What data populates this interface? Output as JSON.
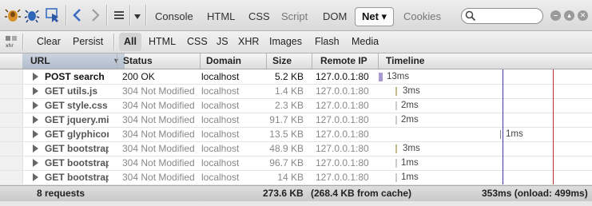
{
  "toolbar": {
    "tabs": [
      {
        "label": "Console"
      },
      {
        "label": "HTML"
      },
      {
        "label": "CSS"
      },
      {
        "label": "Script"
      },
      {
        "label": "DOM"
      },
      {
        "label": "Net ▾"
      },
      {
        "label": "Cookies"
      }
    ],
    "active_tab": "Net",
    "search": {
      "value": "",
      "placeholder": ""
    }
  },
  "net_toolbar": {
    "clear_label": "Clear",
    "persist_label": "Persist",
    "filters": [
      "All",
      "HTML",
      "CSS",
      "JS",
      "XHR",
      "Images",
      "Flash",
      "Media"
    ],
    "active_filter": "All"
  },
  "table": {
    "headers": {
      "url": "URL",
      "status": "Status",
      "domain": "Domain",
      "size": "Size",
      "remote_ip": "Remote IP",
      "timeline": "Timeline"
    },
    "rows": [
      {
        "url": "POST search",
        "status": "200 OK",
        "domain": "localhost",
        "size": "5.2 KB",
        "ip": "127.0.0.1:80",
        "time": "13ms"
      },
      {
        "url": "GET utils.js",
        "status": "304 Not Modified",
        "domain": "localhost",
        "size": "1.4 KB",
        "ip": "127.0.0.1:80",
        "time": "3ms"
      },
      {
        "url": "GET style.css",
        "status": "304 Not Modified",
        "domain": "localhost",
        "size": "2.3 KB",
        "ip": "127.0.0.1:80",
        "time": "2ms"
      },
      {
        "url": "GET jquery.mi",
        "status": "304 Not Modified",
        "domain": "localhost",
        "size": "91.7 KB",
        "ip": "127.0.0.1:80",
        "time": "2ms"
      },
      {
        "url": "GET glyphicon",
        "status": "304 Not Modified",
        "domain": "localhost",
        "size": "13.5 KB",
        "ip": "127.0.0.1:80",
        "time": "1ms"
      },
      {
        "url": "GET bootstrap",
        "status": "304 Not Modified",
        "domain": "localhost",
        "size": "48.9 KB",
        "ip": "127.0.0.1:80",
        "time": "3ms"
      },
      {
        "url": "GET bootstrap",
        "status": "304 Not Modified",
        "domain": "localhost",
        "size": "96.7 KB",
        "ip": "127.0.0.1:80",
        "time": "1ms"
      },
      {
        "url": "GET bootstrap",
        "status": "304 Not Modified",
        "domain": "localhost",
        "size": "14 KB",
        "ip": "127.0.0.1:80",
        "time": "1ms"
      }
    ]
  },
  "summary": {
    "requests": "8 requests",
    "total_size": "273.6 KB",
    "cache": "(268.4 KB from cache)",
    "timing": "353ms (onload: 499ms)"
  },
  "colors": {
    "dom_content_loaded_line": "#3a3aa0",
    "onload_line": "#c03030",
    "bar_waiting": "#b39ddb",
    "bar_receiving": "#c8b98a"
  }
}
